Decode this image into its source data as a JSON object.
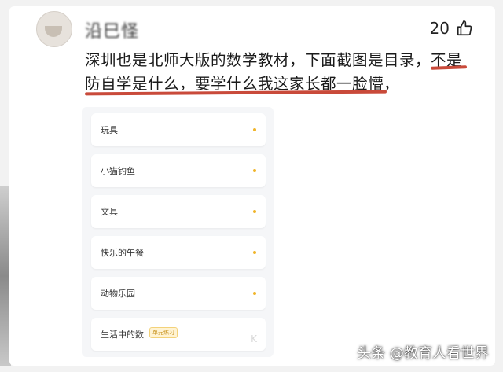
{
  "comment": {
    "username": "沿巳怪",
    "like_count": "20",
    "text_line1_a": "深圳也是北师大版的数学教材，下面截图是目录，",
    "text_line1_b": "不是",
    "text_line2_a": "防自学是什么，要学什么我这家长都一脸懵",
    "text_line2_b": "，",
    "accent_color": "#c94a3a"
  },
  "toc": {
    "items": [
      {
        "label": "玩具"
      },
      {
        "label": "小猫钓鱼"
      },
      {
        "label": "文具"
      },
      {
        "label": "快乐的午餐"
      },
      {
        "label": "动物乐园"
      },
      {
        "label": "生活中的数"
      }
    ],
    "badge": "单元练习",
    "watermark": "K"
  },
  "footer": {
    "source": "头条 @教育人看世界"
  }
}
